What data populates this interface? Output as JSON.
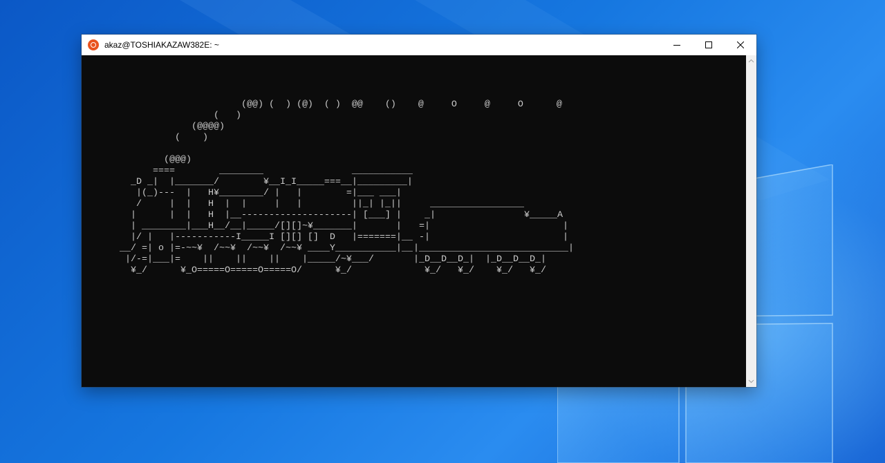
{
  "window": {
    "title": "akaz@TOSHIAKAZAW382E: ~",
    "icon": "ubuntu-icon",
    "controls": [
      "minimize-icon",
      "maximize-icon",
      "close-icon"
    ]
  },
  "terminal": {
    "output": "                       (@@) (  ) (@)  ( )  @@    ()    @     O     @     O      @\n                  (   )\n              (@@@@)\n           (    )\n\n         (@@@)\n       ====        ________                ___________\n   _D _|  |_______/        ¥__I_I_____===__|_________|\n    |(_)---  |   H¥________/ |   |        =|___ ___|\n    /     |  |   H  |  |     |   |         ||_| |_||\n   |      |  |   H  |__--------------------| [___] |\n   | ________|___H__/__|_____/[][]~¥_______|       |\n   |/ |   |-----------I_____I [][] []  D   |=======|__\n __/ =| o |=-~~¥  /~~¥  /~~¥  /~~¥ ____Y___________|__\n  |/-=|___|=    ||    ||    ||    |_____/~¥___/\n   ¥_/      ¥_O=====O=====O=====O/      ¥_/",
    "tender": "                          \n                          \n                          \n                          \n                          \n                          \n                          \n                          \n                          \n   _________________      \n  _|                ¥_____A\n =|                        |\n -|                        |\n|___________________________|\n|_D__D__D_|  |_D__D__D_|   \n  ¥_/   ¥_/    ¥_/   ¥_/   ",
    "background": "#0c0c0c",
    "foreground": "#cccccc"
  },
  "desktop": {
    "wallpaper": "windows-10-hero"
  }
}
